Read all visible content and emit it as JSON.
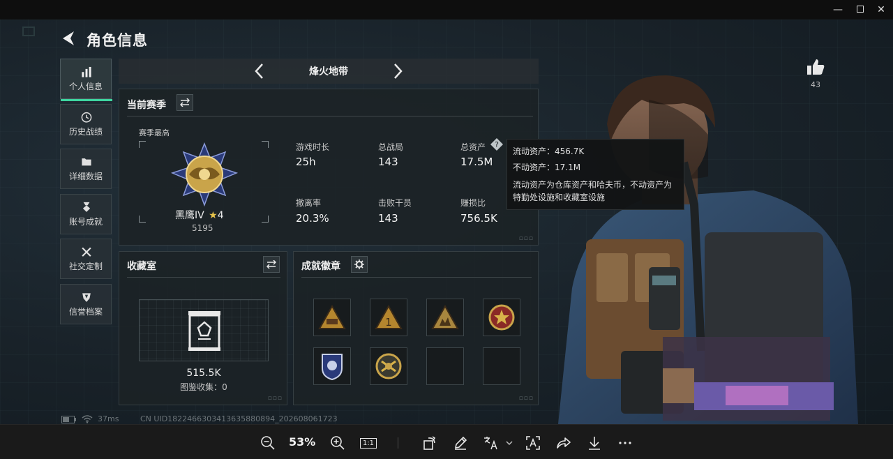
{
  "window": {
    "minimize": "—",
    "close": "✕"
  },
  "header": {
    "title": "角色信息"
  },
  "nav": {
    "items": [
      {
        "label": "个人信息",
        "icon": "bar-chart-icon",
        "active": true
      },
      {
        "label": "历史战绩",
        "icon": "clock-icon"
      },
      {
        "label": "详细数据",
        "icon": "folder-icon"
      },
      {
        "label": "账号成就",
        "icon": "medal-icon"
      },
      {
        "label": "社交定制",
        "icon": "tools-icon"
      },
      {
        "label": "信誉档案",
        "icon": "shield-icon"
      }
    ]
  },
  "map": {
    "name": "烽火地带"
  },
  "season": {
    "title": "当前赛季",
    "best_label": "赛季最高",
    "rank_name": "黑鹰IV",
    "rank_star": "★",
    "rank_stars": "4",
    "rank_score": "5195",
    "stats": [
      {
        "label": "游戏时长",
        "value": "25h"
      },
      {
        "label": "总战局",
        "value": "143"
      },
      {
        "label": "总资产",
        "value": "17.5M"
      },
      {
        "label": "撤离率",
        "value": "20.3%"
      },
      {
        "label": "击败干员",
        "value": "143"
      },
      {
        "label": "赚损比",
        "value": "756.5K"
      }
    ]
  },
  "tooltip": {
    "liquid": "流动资产：456.7K",
    "fixed": "不动资产：17.1M",
    "note": "流动资产为仓库资产和哈夫币，不动资产为特勤处设施和收藏室设施"
  },
  "collection": {
    "title": "收藏室",
    "value": "515.5K",
    "sub": "图鉴收集：0"
  },
  "achievements": {
    "title": "成就徽章"
  },
  "like": {
    "count": "43"
  },
  "status": {
    "ping": "37ms",
    "uid": "CN UID1822466303413635880894_202608061723"
  },
  "toolbar": {
    "zoom": "53%",
    "actual_size": "1:1"
  },
  "colors": {
    "accent": "#3fd6a0",
    "gold": "#c9a44a",
    "panel": "#1c2226"
  }
}
